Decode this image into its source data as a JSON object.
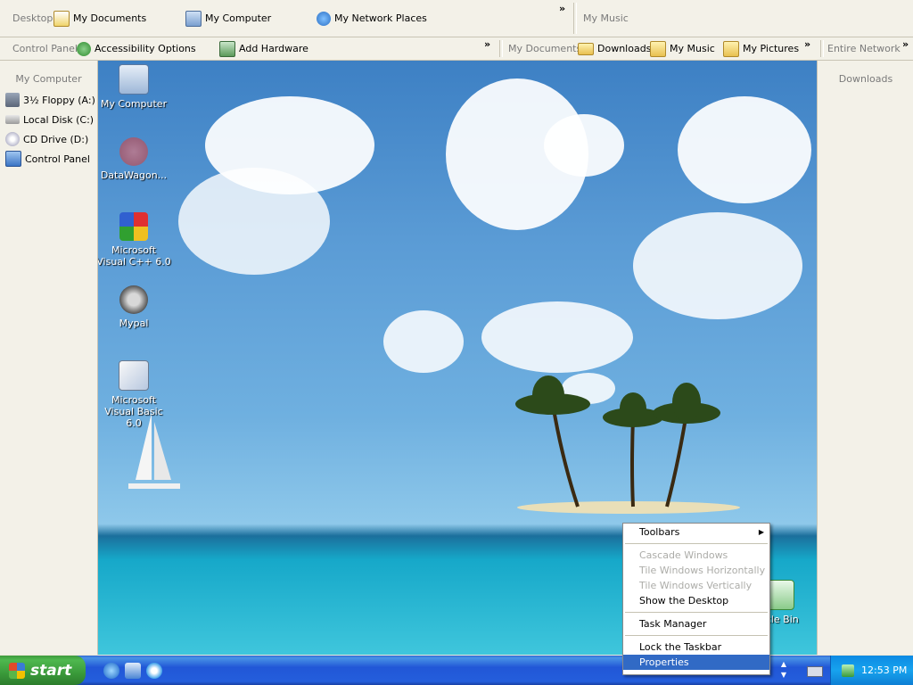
{
  "toolbar_row1": {
    "section1_label": "Desktop",
    "items": [
      {
        "label": "My Documents",
        "icon": "my-documents-icon"
      },
      {
        "label": "My Computer",
        "icon": "my-computer-icon"
      },
      {
        "label": "My Network Places",
        "icon": "network-places-icon"
      }
    ],
    "overflow": "»",
    "section2_label": "My Music"
  },
  "toolbar_row2": {
    "section1_label": "Control Panel",
    "items": [
      {
        "label": "Accessibility Options",
        "icon": "accessibility-icon"
      },
      {
        "label": "Add Hardware",
        "icon": "add-hardware-icon"
      }
    ],
    "overflow1": "»",
    "section2_label": "My Documents",
    "items2": [
      {
        "label": "Downloads",
        "icon": "folder-icon"
      },
      {
        "label": "My Music",
        "icon": "music-folder-icon"
      },
      {
        "label": "My Pictures",
        "icon": "pictures-folder-icon"
      }
    ],
    "overflow2": "»",
    "section3_label": "Entire Network",
    "overflow3": "»"
  },
  "left_sidebar": {
    "title": "My Computer",
    "items": [
      {
        "label": "3½ Floppy (A:)",
        "icon": "floppy-icon"
      },
      {
        "label": "Local Disk (C:)",
        "icon": "hard-disk-icon"
      },
      {
        "label": "CD Drive (D:)",
        "icon": "cd-drive-icon"
      },
      {
        "label": "Control Panel",
        "icon": "control-panel-icon"
      }
    ]
  },
  "right_sidebar": {
    "title": "Downloads"
  },
  "desktop_icons": [
    {
      "label": "My Computer",
      "icon": "my-computer-icon"
    },
    {
      "label": "DataWagon...",
      "icon": "datawagon-icon"
    },
    {
      "label": "Microsoft Visual C++ 6.0",
      "icon": "visual-cpp-icon"
    },
    {
      "label": "Mypal",
      "icon": "mypal-icon"
    },
    {
      "label": "Microsoft Visual Basic 6.0",
      "icon": "visual-basic-icon"
    },
    {
      "label": "ycle Bin",
      "icon": "recycle-bin-icon"
    }
  ],
  "context_menu": {
    "items": [
      {
        "label": "Toolbars",
        "state": "normal",
        "submenu": true
      },
      {
        "label": "Cascade Windows",
        "state": "disabled"
      },
      {
        "label": "Tile Windows Horizontally",
        "state": "disabled"
      },
      {
        "label": "Tile Windows Vertically",
        "state": "disabled"
      },
      {
        "label": "Show the Desktop",
        "state": "normal"
      },
      {
        "label": "Task Manager",
        "state": "normal"
      },
      {
        "label": "Lock the Taskbar",
        "state": "normal"
      },
      {
        "label": "Properties",
        "state": "selected"
      }
    ],
    "submenu_arrow": "▶"
  },
  "taskbar": {
    "start_label": "start",
    "quick_launch": [
      "ie-icon",
      "outlook-express-icon",
      "media-player-icon"
    ],
    "clock": "12:53 PM",
    "colors": {
      "taskbar": "#245edc",
      "start": "#3a9a3a",
      "tray": "#0c8ae3",
      "selection": "#316ac5"
    }
  }
}
